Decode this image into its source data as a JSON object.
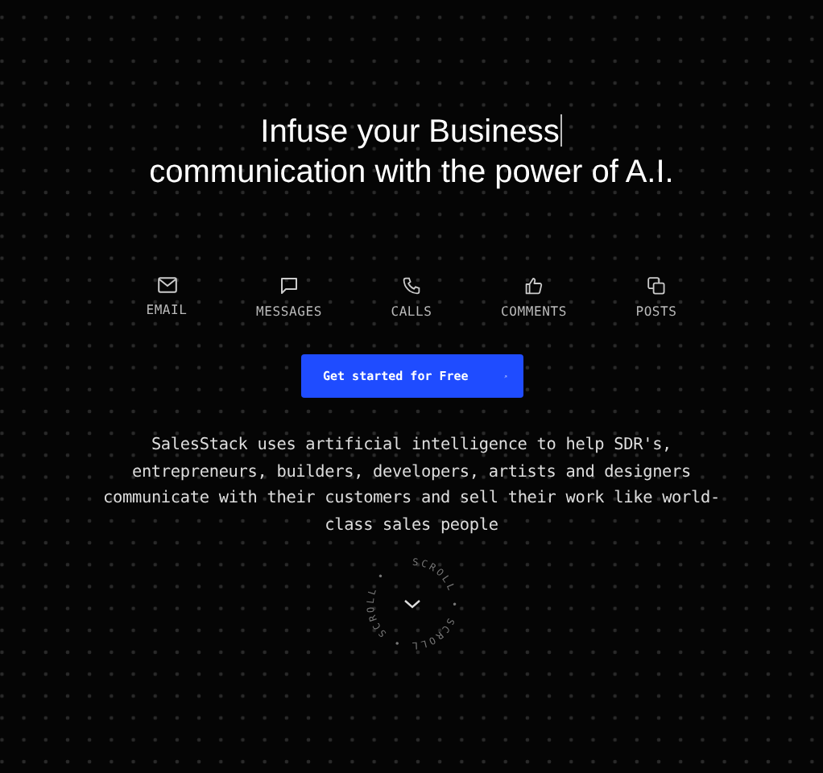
{
  "headline": {
    "line1": "Infuse your Business",
    "line2": "communication with the power of A.I.",
    "cursor": true
  },
  "channels": [
    {
      "kind": "email",
      "label": "EMAIL"
    },
    {
      "kind": "message",
      "label": "MESSAGES"
    },
    {
      "kind": "phone",
      "label": "CALLS"
    },
    {
      "kind": "thumb",
      "label": "COMMENTS"
    },
    {
      "kind": "copy",
      "label": "POSTS"
    }
  ],
  "cta": {
    "label": "Get started for Free"
  },
  "description": "SalesStack uses artificial intelligence to help SDR's, entrepreneurs, builders, developers, artists and designers communicate with their customers and sell their work like world-class sales people",
  "scroll": {
    "ring_text": "SCROLL • SCROLL • SCROLL •"
  }
}
